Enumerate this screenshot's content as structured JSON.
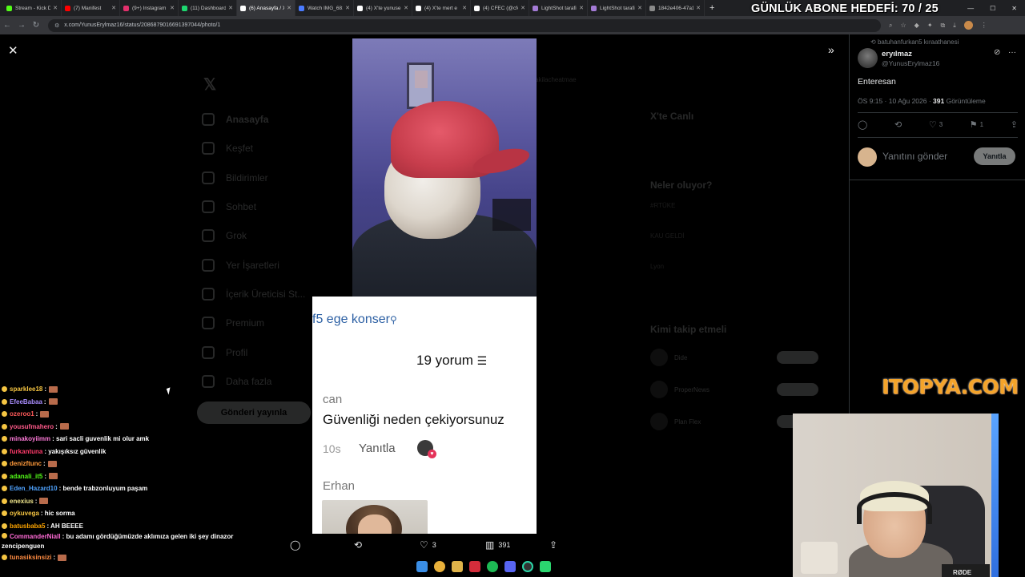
{
  "browser": {
    "tabs": [
      {
        "label": "Stream - Kick D",
        "color": "#53fc18",
        "active": false
      },
      {
        "label": "(7) Manifest",
        "color": "#ff0000",
        "active": false
      },
      {
        "label": "(9+) Instagram",
        "color": "#e1306c",
        "active": false
      },
      {
        "label": "(11) Dashboard",
        "color": "#1dd66f",
        "active": false
      },
      {
        "label": "(6) Anasayfa / X",
        "color": "#ffffff",
        "active": true
      },
      {
        "label": "Watch IMG_681",
        "color": "#4a7bff",
        "active": false
      },
      {
        "label": "(4) X'te yunuse",
        "color": "#ffffff",
        "active": false
      },
      {
        "label": "(4) X'te mert e",
        "color": "#ffffff",
        "active": false
      },
      {
        "label": "(4) CFEC (@cfe",
        "color": "#ffffff",
        "active": false
      },
      {
        "label": "LightShot tarafi",
        "color": "#a47bd6",
        "active": false
      },
      {
        "label": "LightShot tarafi",
        "color": "#a47bd6",
        "active": false
      },
      {
        "label": "1842e406-47a1",
        "color": "#8a8a8a",
        "active": false
      }
    ],
    "url": "x.com/YunusErylmaz16/status/20868790166913970​44/photo/1"
  },
  "stream_goal": "GÜNLÜK ABONE HEDEFİ: 70 / 25",
  "x_background": {
    "nav": [
      "Anasayfa",
      "Keşfet",
      "Bildirimler",
      "Sohbet",
      "Grok",
      "Yer İşaretleri",
      "İçerik Üreticisi St...",
      "Premium",
      "Profil",
      "Daha fazla"
    ],
    "post_button": "Gönderi yayınla",
    "right_heading_1": "X'te Canlı",
    "right_heading_2": "Neler oluyor?",
    "trends": [
      "#RTÜKE",
      "KAU GELDİ",
      "Lyon",
      ""
    ],
    "right_heading_3": "Kimi takip etmeli",
    "follow": [
      "Dide",
      "ProperNews",
      "Plan Flex"
    ],
    "top_strip": "akilacheatmae"
  },
  "viewer": {
    "close_icon": "close-icon",
    "expand_icon": "double-chevron-right-icon",
    "comment_card": {
      "search_text": "f5 ege konser",
      "count_text": "19 yorum",
      "user1": "can",
      "text1": "Güvenliği neden çekiyorsunuz",
      "time1": "10s",
      "reply1": "Yanıtla",
      "user2": "Erhan"
    },
    "actions": {
      "retweet_count": "",
      "like_count": "3",
      "views_count": "391"
    }
  },
  "tweet_panel": {
    "reposted_by": "batuhanfurkan5 kıraathanesi",
    "name": "eryılmaz",
    "handle": "@YunusErylmaz16",
    "text": "Enteresan",
    "meta_time": "ÖS 9:15 · 10 Ağu 2026 · ",
    "meta_views": "391",
    "meta_views_label": " Görüntüleme",
    "like_count": "3",
    "bookmark_count": "1",
    "reply_placeholder": "Yanıtını gönder",
    "reply_button": "Yanıtla"
  },
  "brand_overlay": "ITOPYA.COM",
  "webcam_mic_label": "RØDE",
  "chat": [
    {
      "user": "sparklee18",
      "color": "#f5c542",
      "msg": ":",
      "emote": true
    },
    {
      "user": "EfeeBabaa",
      "color": "#a78bfa",
      "msg": ":",
      "emote": true
    },
    {
      "user": "ozeroo1",
      "color": "#ff5a5a",
      "msg": ":",
      "emote": true
    },
    {
      "user": "yousufmahero",
      "color": "#ff5a8a",
      "msg": ":",
      "emote": true
    },
    {
      "user": "minakoyiimm",
      "color": "#ff7ad9",
      "msg": ": sari sacli guvenlik mi olur amk",
      "emote": false
    },
    {
      "user": "furkantuna",
      "color": "#ff3b6b",
      "msg": ": yakışıksız güvenlik",
      "emote": false
    },
    {
      "user": "denizftunc",
      "color": "#ff9a3b",
      "msg": ":",
      "emote": true
    },
    {
      "user": "adanali_it5",
      "color": "#53fc18",
      "msg": ":",
      "emote": true
    },
    {
      "user": "Eden_Hazard10",
      "color": "#4fa3ff",
      "msg": ": bende trabzonluyum paşam",
      "emote": false
    },
    {
      "user": "enexius",
      "color": "#f0e68c",
      "msg": ":",
      "emote": true
    },
    {
      "user": "oykuvega",
      "color": "#f5c542",
      "msg": ": hic sorma",
      "emote": false
    },
    {
      "user": "batusbaba5",
      "color": "#ffa500",
      "msg": ": AH BEEEE",
      "emote": false
    },
    {
      "user": "CommanderNiall",
      "color": "#ff6bd6",
      "msg": ": bu adamı gördüğümüzde aklımıza gelen iki şey dinazor zencipenguen",
      "emote": false
    },
    {
      "user": "tunasiksinsizi",
      "color": "#ff8c42",
      "msg": ":",
      "emote": true
    }
  ],
  "colors": {
    "accent_blue": "#1d9bf0",
    "brand_orange": "#f4a42a",
    "search_blue": "#2b5fa3"
  }
}
